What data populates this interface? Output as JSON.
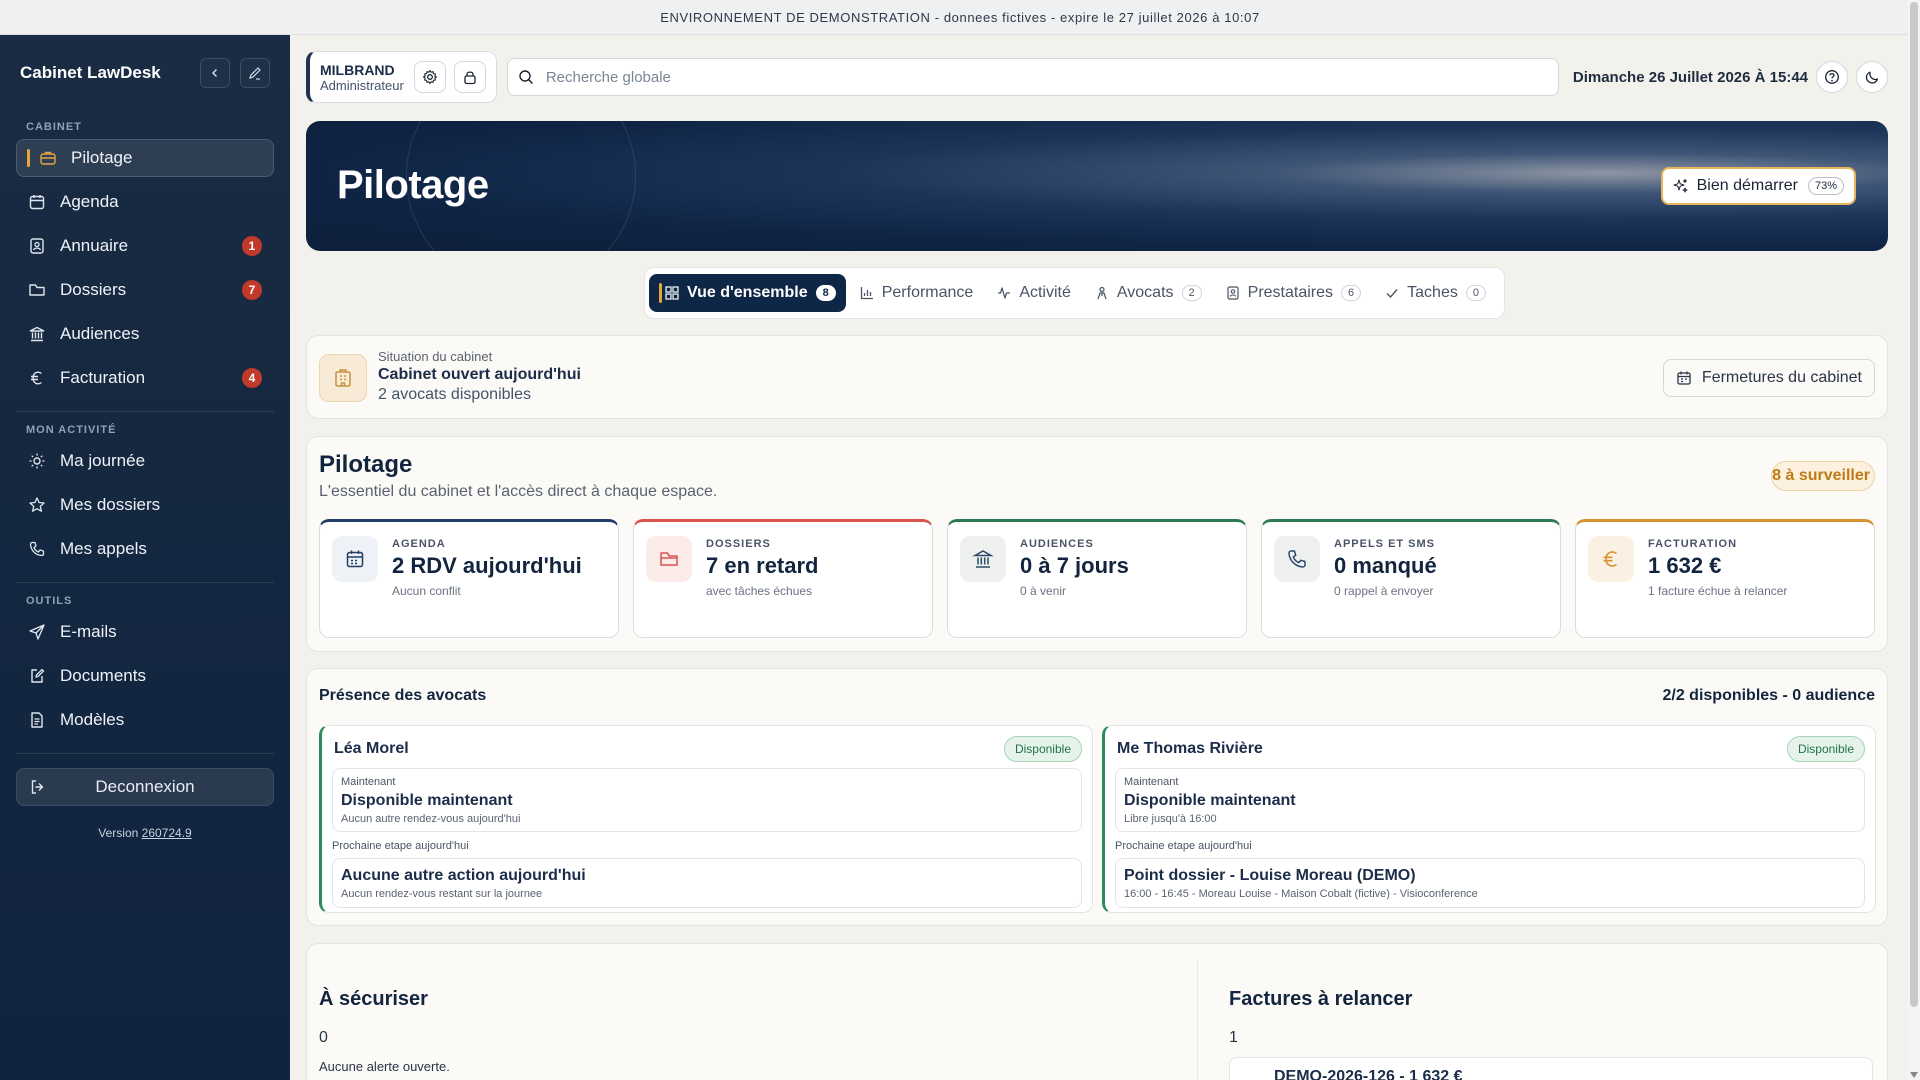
{
  "banner": "ENVIRONNEMENT DE DEMONSTRATION - donnees fictives - expire le 27 juillet 2026 à 10:07",
  "sidebar": {
    "title": "Cabinet LawDesk",
    "sections": {
      "cabinet": "CABINET",
      "activity": "MON ACTIVITÉ",
      "tools": "OUTILS"
    },
    "cabinet_items": [
      {
        "label": "Pilotage",
        "icon": "briefcase-icon",
        "badge": null,
        "active": true
      },
      {
        "label": "Agenda",
        "icon": "calendar-icon",
        "badge": null
      },
      {
        "label": "Annuaire",
        "icon": "contacts-icon",
        "badge": "1"
      },
      {
        "label": "Dossiers",
        "icon": "folder-icon",
        "badge": "7"
      },
      {
        "label": "Audiences",
        "icon": "courthouse-icon",
        "badge": null
      },
      {
        "label": "Facturation",
        "icon": "euro-icon",
        "badge": "4"
      }
    ],
    "activity_items": [
      {
        "label": "Ma journée",
        "icon": "sun-icon"
      },
      {
        "label": "Mes dossiers",
        "icon": "star-icon"
      },
      {
        "label": "Mes appels",
        "icon": "phone-icon"
      }
    ],
    "tool_items": [
      {
        "label": "E-mails",
        "icon": "send-icon"
      },
      {
        "label": "Documents",
        "icon": "document-edit-icon"
      },
      {
        "label": "Modèles",
        "icon": "template-icon"
      }
    ],
    "logout": "Deconnexion",
    "version_prefix": "Version",
    "version": "260724.9"
  },
  "topbar": {
    "user_name": "MILBRAND",
    "user_role": "Administrateur",
    "search_placeholder": "Recherche globale",
    "datetime": "Dimanche 26 Juillet 2026 À 15:44"
  },
  "hero": {
    "title": "Pilotage",
    "button_label": "Bien démarrer",
    "progress": "73%"
  },
  "tabs": [
    {
      "label": "Vue d'ensemble",
      "count": "8",
      "icon": "grid-icon",
      "active": true
    },
    {
      "label": "Performance",
      "count": null,
      "icon": "bar-chart-icon"
    },
    {
      "label": "Activité",
      "count": null,
      "icon": "activity-icon"
    },
    {
      "label": "Avocats",
      "count": "2",
      "icon": "person-icon"
    },
    {
      "label": "Prestataires",
      "count": "6",
      "icon": "contacts-icon"
    },
    {
      "label": "Taches",
      "count": "0",
      "icon": "check-icon"
    }
  ],
  "situation": {
    "kicker": "Situation du cabinet",
    "title": "Cabinet ouvert aujourd'hui",
    "subtitle": "2 avocats disponibles",
    "button": "Fermetures du cabinet"
  },
  "pilotage": {
    "title": "Pilotage",
    "subtitle": "L'essentiel du cabinet et l'accès direct à chaque espace.",
    "badge": "8 à surveiller",
    "kpis": [
      {
        "label": "AGENDA",
        "value": "2 RDV aujourd'hui",
        "sub": "Aucun conflit",
        "icon": "calendar-icon",
        "color": "#1f3d66",
        "bg": "#eef1f5"
      },
      {
        "label": "DOSSIERS",
        "value": "7 en retard",
        "sub": "avec tâches échues",
        "icon": "folder-icon",
        "color": "#d9534f",
        "bg": "#fbecea"
      },
      {
        "label": "AUDIENCES",
        "value": "0 à 7 jours",
        "sub": "0 à venir",
        "icon": "courthouse-icon",
        "color": "#2c7a55",
        "bg": "#eef1f0"
      },
      {
        "label": "APPELS ET SMS",
        "value": "0 manqué",
        "sub": "0 rappel à envoyer",
        "icon": "phone-icon",
        "color": "#2c7a55",
        "bg": "#eef1f0"
      },
      {
        "label": "FACTURATION",
        "value": "1 632 €",
        "sub": "1 facture échue à relancer",
        "icon": "euro-icon",
        "color": "#d9902f",
        "bg": "#fbf1e2"
      }
    ]
  },
  "presence": {
    "title": "Présence des avocats",
    "summary": "2/2 disponibles - 0 audience",
    "now_label": "Maintenant",
    "next_label": "Prochaine etape aujourd'hui",
    "lawyers": [
      {
        "name": "Léa Morel",
        "status": "Disponible",
        "now_title": "Disponible maintenant",
        "now_sub": "Aucun autre rendez-vous aujourd'hui",
        "next_title": "Aucune autre action aujourd'hui",
        "next_sub": "Aucun rendez-vous restant sur la journee"
      },
      {
        "name": "Me Thomas Rivière",
        "status": "Disponible",
        "now_title": "Disponible maintenant",
        "now_sub": "Libre jusqu'à 16:00",
        "next_title": "Point dossier - Louise Moreau (DEMO)",
        "next_sub": "16:00 - 16:45 - Moreau Louise - Maison Cobalt (fictive) - Visioconference"
      }
    ]
  },
  "bottom": {
    "secure": {
      "title": "À sécuriser",
      "count": "0",
      "note": "Aucune alerte ouverte."
    },
    "invoices": {
      "title": "Factures à relancer",
      "count": "1",
      "first_row": "DEMO-2026-126 - 1 632 €"
    }
  },
  "colors": {
    "sidebar_bg": "#152840",
    "accent_gold": "#e2a63c",
    "badge_red": "#c0392b",
    "tab_active": "#0f2747",
    "status_green": "#2c8c5e"
  }
}
